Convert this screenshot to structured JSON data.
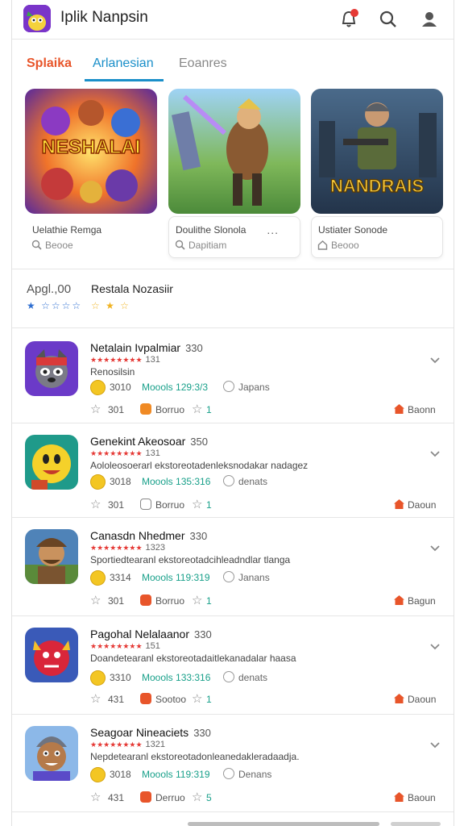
{
  "app": {
    "title": "Iplik Nanpsin"
  },
  "tabs": [
    {
      "label": "Splaika"
    },
    {
      "label": "Arlanesian"
    },
    {
      "label": "Eoanres"
    }
  ],
  "featured": [
    {
      "banner": "NESHALAI",
      "title": "Uelathie Remga",
      "sub": "Beooe"
    },
    {
      "banner": "",
      "title": "Doulithe Slonola",
      "sub": "Dapitiam",
      "more": "..."
    },
    {
      "banner": "NANDRAIS",
      "title": "Ustiater Sonode",
      "sub": "Beooo"
    }
  ],
  "rating": {
    "left_label": "Apgl.,00",
    "left_stars": "★ ☆☆☆☆",
    "right_label": "Restala Nozasiir",
    "right_stars": "☆ ★ ☆"
  },
  "items": [
    {
      "title": "Netalain Ivpalmiar",
      "num": "330",
      "stars": "★★★★★★★★",
      "score": "131",
      "desc": "Renosilsin",
      "count": "3010",
      "mode": "Moools 129:3/3",
      "place": "Japans",
      "act_count": "301",
      "source": "Borruo",
      "act_num": "1",
      "region": "Baonn",
      "badge_color": "#f08a24",
      "icon": "raccoon"
    },
    {
      "title": "Genekint Akeosoar",
      "num": "350",
      "stars": "★★★★★★★★",
      "score": "131",
      "desc": "Aololeosoerarl ekstoreotadenleksnodakar nadagez",
      "count": "3018",
      "mode": "Moools 135:316",
      "place": "denats",
      "act_count": "301",
      "source": "Borruo",
      "act_num": "1",
      "region": "Daoun",
      "badge_color": "#ffffff",
      "icon": "blob"
    },
    {
      "title": "Canasdn Nhedmer",
      "num": "330",
      "stars": "★★★★★★★★",
      "score": "1323",
      "desc": "Sportiedtearanl ekstoreotadcihleadndlar tlanga",
      "count": "3314",
      "mode": "Moools 119:319",
      "place": "Janans",
      "act_count": "301",
      "source": "Borruo",
      "act_num": "1",
      "region": "Bagun",
      "badge_color": "#e8552a",
      "icon": "warrior"
    },
    {
      "title": "Pagohal Nelalaanor",
      "num": "330",
      "stars": "★★★★★★★★",
      "score": "151",
      "desc": "Doandetearanl ekstoreotadaitlekanadalar haasa",
      "count": "3310",
      "mode": "Moools 133:316",
      "place": "denats",
      "act_count": "431",
      "source": "Sootoo",
      "act_num": "1",
      "region": "Daoun",
      "badge_color": "#e8552a",
      "icon": "devil"
    },
    {
      "title": "Seagoar Nineaciets",
      "num": "330",
      "stars": "★★★★★★★★",
      "score": "1321",
      "desc": "Nepdetearanl ekstoreotadonleanedakleradaadja.",
      "count": "3018",
      "mode": "Moools 119:319",
      "place": "Denans",
      "act_count": "431",
      "source": "Derruo",
      "act_num": "5",
      "region": "Baoun",
      "badge_color": "#e8552a",
      "icon": "knight"
    }
  ],
  "colors": {
    "accent": "#e8552a",
    "tab_active": "#1a8fc9",
    "meta_green": "#18a08a",
    "star_red": "#e53935"
  }
}
